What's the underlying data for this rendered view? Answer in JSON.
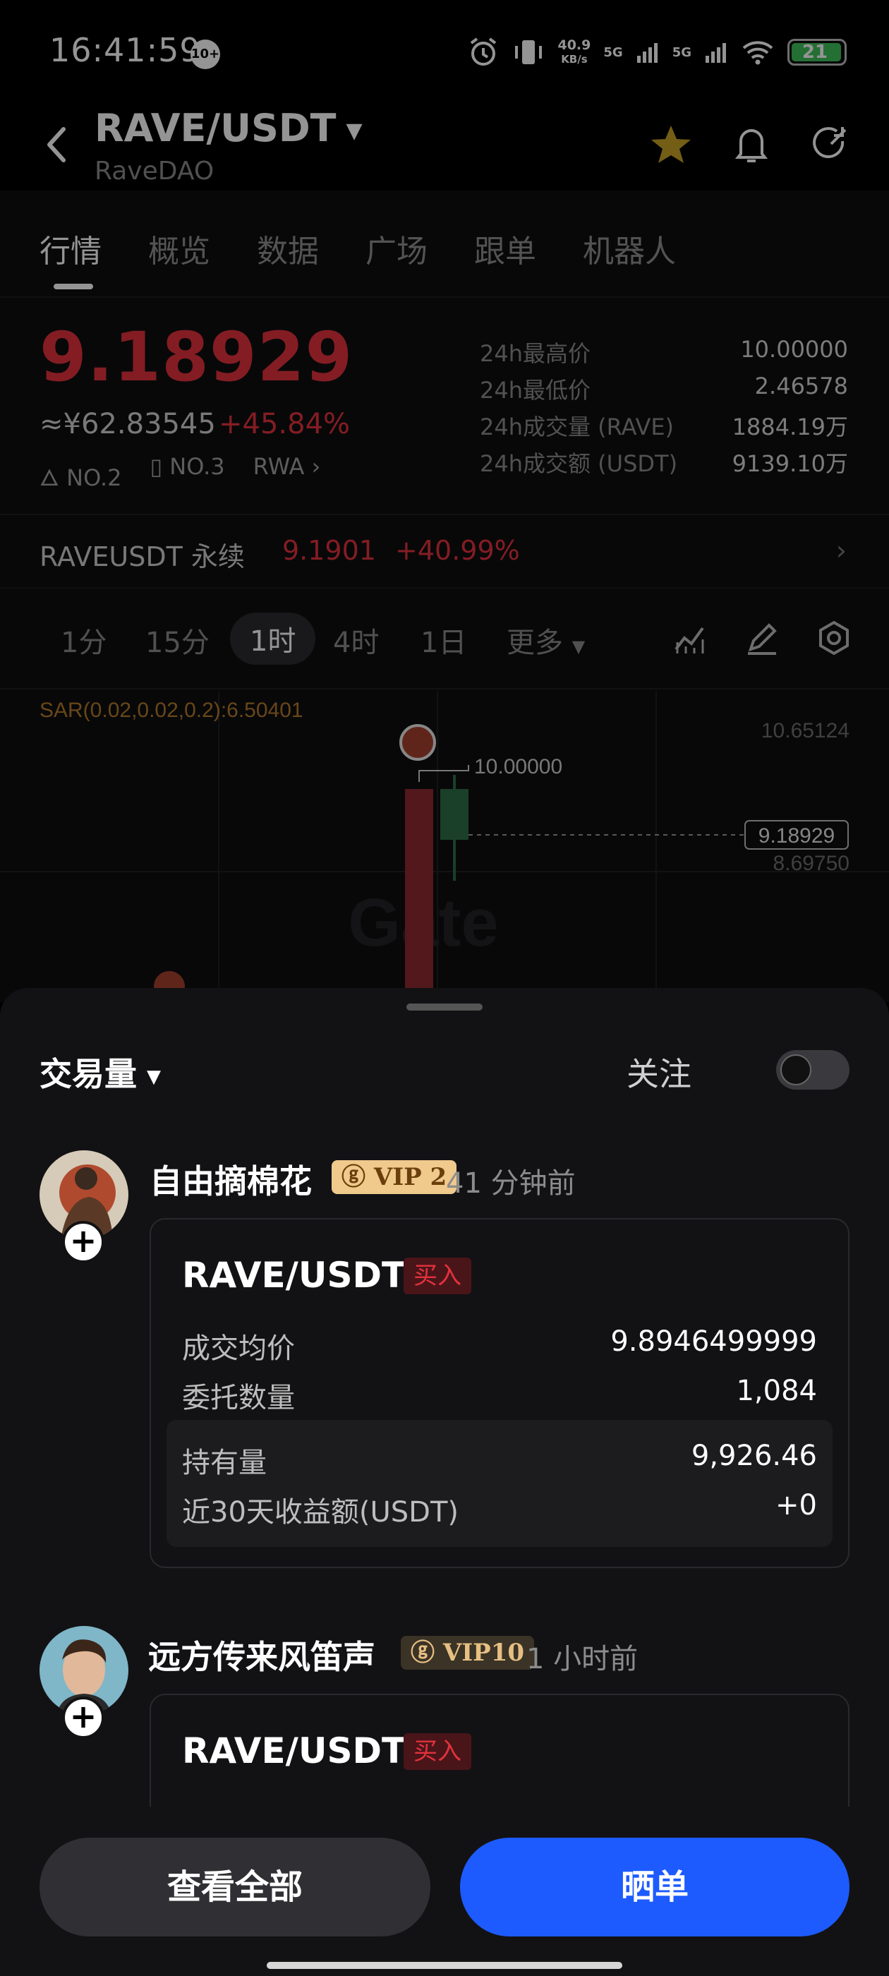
{
  "status_bar": {
    "time": "16:41:59",
    "notif_badge": "10+",
    "net_speed_value": "40.9",
    "net_speed_unit": "KB/s",
    "sim1": "5G",
    "sim2": "5G",
    "battery": "21"
  },
  "header": {
    "pair": "RAVE/USDT",
    "subtitle": "RaveDAO",
    "favorite_color": "#c9a227"
  },
  "tabs": [
    "行情",
    "概览",
    "数据",
    "广场",
    "跟单",
    "机器人"
  ],
  "price": {
    "last": "9.18929",
    "cny": "≈¥62.83545",
    "change": "+45.84%",
    "tags": [
      "NO.2",
      "NO.3",
      "RWA"
    ],
    "stats": [
      {
        "label": "24h最高价",
        "value": "10.00000"
      },
      {
        "label": "24h最低价",
        "value": "2.46578"
      },
      {
        "label": "24h成交量 (RAVE)",
        "value": "1884.19万"
      },
      {
        "label": "24h成交额 (USDT)",
        "value": "9139.10万"
      }
    ]
  },
  "perpetual": {
    "name": "RAVEUSDT 永续",
    "price": "9.1901",
    "change": "+40.99%"
  },
  "intervals": {
    "items": [
      "1分",
      "15分",
      "1时",
      "4时",
      "1日",
      "更多"
    ],
    "active": "1时"
  },
  "chart": {
    "indicator": "SAR(0.02,0.02,0.2):6.50401",
    "axis_top": "10.65124",
    "high_label": "10.00000",
    "current_price": "9.18929",
    "axis_mid": "8.69750",
    "watermark": "Gate"
  },
  "sheet": {
    "title": "交易量",
    "follow_label": "关注",
    "follow_on": false
  },
  "posts": [
    {
      "user": "自由摘棉花",
      "vip": "VIP 2",
      "ago": "41 分钟前",
      "pair": "RAVE/USDT",
      "side": "买入",
      "rows": [
        {
          "label": "成交均价",
          "value": "9.8946499999"
        },
        {
          "label": "委托数量",
          "value": "1,084"
        }
      ],
      "holdings": [
        {
          "label": "持有量",
          "value": "9,926.46"
        },
        {
          "label": "近30天收益额(USDT)",
          "value": "+0"
        }
      ]
    },
    {
      "user": "远方传来风笛声",
      "vip": "VIP10",
      "ago": "1 小时前",
      "pair": "RAVE/USDT",
      "side": "买入"
    }
  ],
  "actions": {
    "view_all": "查看全部",
    "share": "晒单"
  }
}
